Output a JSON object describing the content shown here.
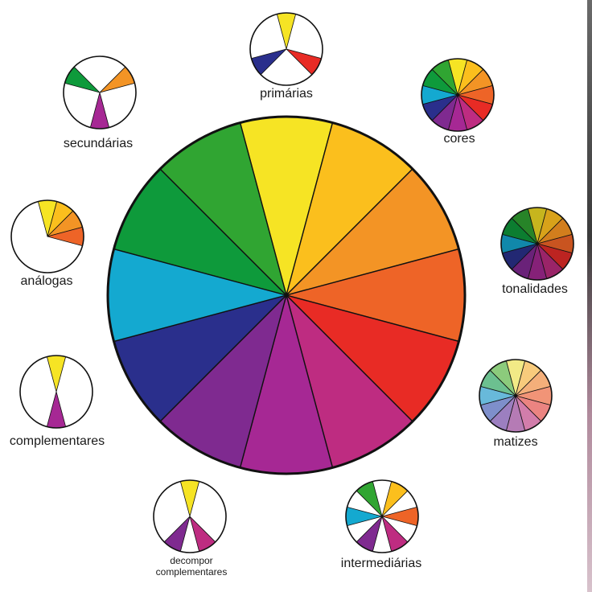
{
  "colors": {
    "wheel": [
      "#F6E424",
      "#FBBF1D",
      "#F39425",
      "#EE6427",
      "#E82B25",
      "#BE2C81",
      "#A62894",
      "#7F2A90",
      "#2A2F8C",
      "#14A9D0",
      "#0E9A3B",
      "#30A532"
    ],
    "pastel": [
      "#F2EA86",
      "#F8CB7C",
      "#F4AF7A",
      "#F19477",
      "#EB8481",
      "#D27DAB",
      "#B57BB5",
      "#9C7FC0",
      "#7E8FCB",
      "#68B9DA",
      "#6CC090",
      "#8CCB7C"
    ],
    "dark": [
      "#C6B51E",
      "#D8A21A",
      "#D27E1D",
      "#C95420",
      "#BD2421",
      "#9A2468",
      "#862178",
      "#6A2279",
      "#222873",
      "#1188AA",
      "#0C7D30",
      "#278428"
    ],
    "outline": "#111111",
    "background": "#ffffff"
  },
  "main_wheel": {
    "segments": 12
  },
  "satellites": [
    {
      "id": "primarias",
      "label": "primárias",
      "type": "partial",
      "colored": [
        0,
        4,
        8
      ],
      "palette": "wheel"
    },
    {
      "id": "cores",
      "label": "cores",
      "type": "full",
      "palette": "wheel"
    },
    {
      "id": "tonalidades",
      "label": "tonalidades",
      "type": "full",
      "palette": "dark"
    },
    {
      "id": "matizes",
      "label": "matizes",
      "type": "full",
      "palette": "pastel"
    },
    {
      "id": "intermediarias",
      "label": "intermediárias",
      "type": "partial",
      "colored": [
        1,
        3,
        5,
        7,
        9,
        11
      ],
      "palette": "wheel"
    },
    {
      "id": "decompor",
      "label": [
        "decompor",
        "complementares"
      ],
      "type": "partial",
      "colored": [
        0,
        5,
        7
      ],
      "palette": "wheel"
    },
    {
      "id": "complementares",
      "label": "complementares",
      "type": "partial",
      "colored": [
        0,
        6
      ],
      "palette": "wheel"
    },
    {
      "id": "analogas",
      "label": "análogas",
      "type": "partial",
      "colored": [
        0,
        1,
        2,
        3
      ],
      "palette": "wheel"
    },
    {
      "id": "secundarias",
      "label": "secundárias",
      "type": "partial",
      "colored": [
        2,
        6,
        10
      ],
      "palette": "wheel"
    }
  ]
}
